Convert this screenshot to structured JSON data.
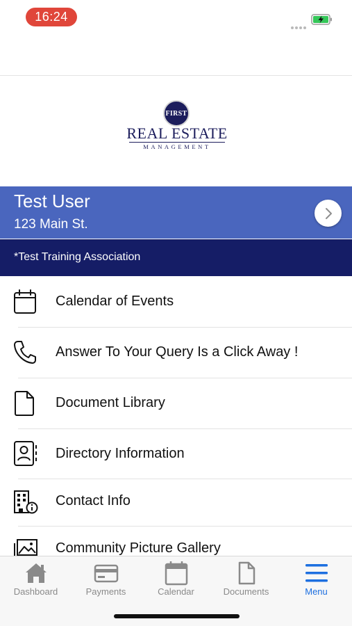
{
  "status_bar": {
    "time": "16:24"
  },
  "logo": {
    "circle_text": "FIRST",
    "main_text": "REAL ESTATE",
    "sub_text": "MANAGEMENT"
  },
  "user": {
    "name": "Test User",
    "address": "123 Main St.",
    "association": "*Test Training Association"
  },
  "menu": {
    "items": [
      {
        "label": "Calendar of Events",
        "icon": "calendar-icon"
      },
      {
        "label": "Answer To Your Query Is a Click Away !",
        "icon": "phone-icon"
      },
      {
        "label": "Document Library",
        "icon": "document-icon"
      },
      {
        "label": "Directory Information",
        "icon": "contact-card-icon"
      },
      {
        "label": "Contact Info",
        "icon": "building-info-icon"
      },
      {
        "label": "Community Picture Gallery",
        "icon": "picture-icon"
      }
    ]
  },
  "tab_bar": {
    "tabs": [
      {
        "label": "Dashboard",
        "icon": "home-icon"
      },
      {
        "label": "Payments",
        "icon": "credit-card-icon"
      },
      {
        "label": "Calendar",
        "icon": "calendar-icon"
      },
      {
        "label": "Documents",
        "icon": "document-icon"
      },
      {
        "label": "Menu",
        "icon": "hamburger-menu-icon"
      }
    ],
    "active_tab": "Menu"
  },
  "colors": {
    "time_pill": "#e0463a",
    "user_banner": "#4a66be",
    "association_bar": "#151d66",
    "active_tab": "#1d6fe0",
    "inactive_tab": "#8a8a8a",
    "logo_navy": "#1c1d5c"
  }
}
